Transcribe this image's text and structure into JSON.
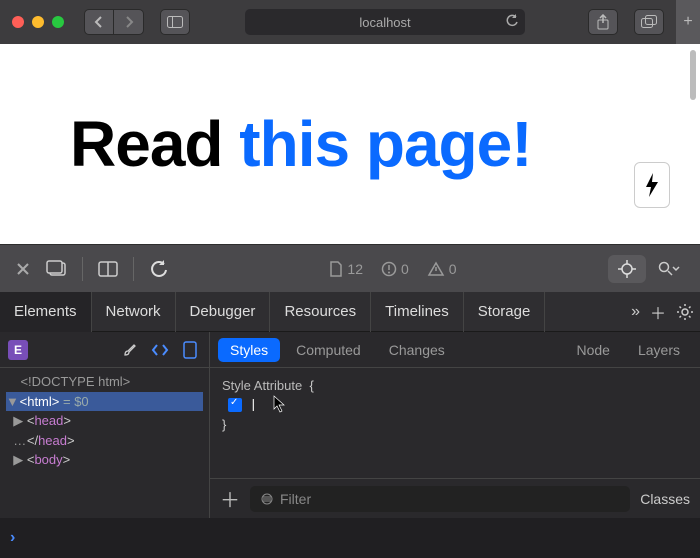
{
  "browser": {
    "address": "localhost",
    "icons": {
      "back": "chevron-left",
      "forward": "chevron-right",
      "sidebar": "sidebar",
      "reload": "reload",
      "share": "share",
      "tabs": "tabs",
      "plus": "+"
    }
  },
  "page": {
    "hero_black": "Read ",
    "hero_blue": "this page!",
    "bolt": "⧘"
  },
  "devtools": {
    "toolbar": {
      "counts": {
        "resources": "12",
        "errors": "0",
        "warnings": "0"
      }
    },
    "tabs": [
      "Elements",
      "Network",
      "Debugger",
      "Resources",
      "Timelines",
      "Storage"
    ],
    "active_tab": "Elements",
    "more": "»",
    "subtabs": [
      "Styles",
      "Computed",
      "Changes",
      "Node",
      "Layers"
    ],
    "active_subtab": "Styles",
    "dom": [
      {
        "indent": 1,
        "disc": "",
        "html": "<!DOCTYPE html>",
        "cls": "doctype"
      },
      {
        "indent": 0,
        "disc": "▼",
        "html": "<html>",
        "tail": " = $0",
        "sel": true
      },
      {
        "indent": 1,
        "disc": "▶",
        "html": "<head>"
      },
      {
        "indent": 1,
        "disc": "…",
        "html": "</head>"
      },
      {
        "indent": 1,
        "disc": "▶",
        "html": "<body>"
      }
    ],
    "styles": {
      "header": "Style Attribute",
      "open": "{",
      "close": "}",
      "caret": "|",
      "filter_placeholder": "Filter",
      "classes_btn": "Classes",
      "add": "＋"
    },
    "console_prompt": "›"
  }
}
